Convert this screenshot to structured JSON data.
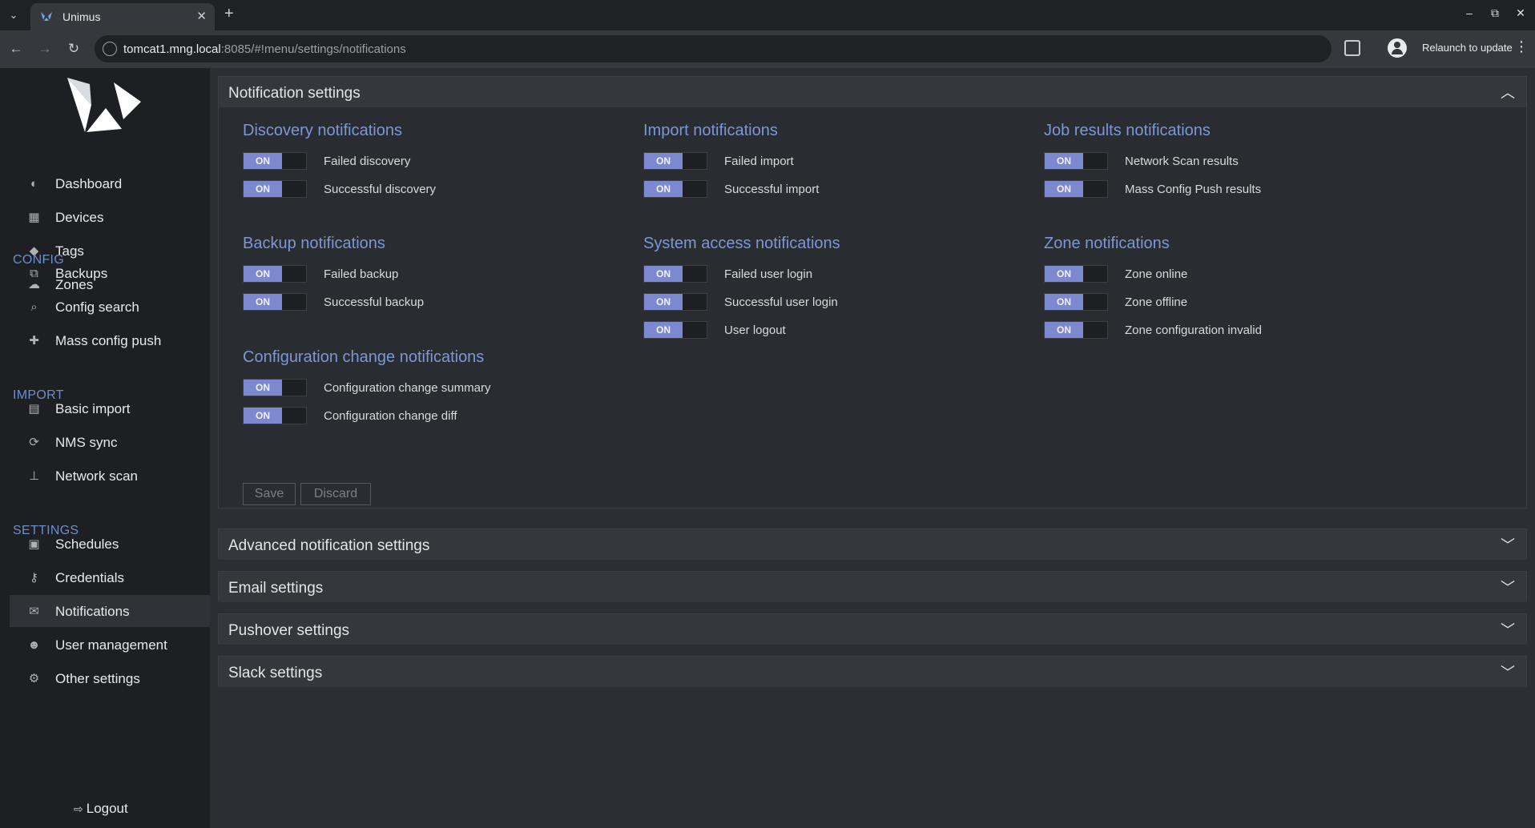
{
  "browser": {
    "tab_title": "Unimus",
    "url_host": "tomcat1.mng.local",
    "url_rest": ":8085/#!menu/settings/notifications",
    "relaunch_label": "Relaunch to update"
  },
  "sidebar": {
    "items_main": [
      {
        "label": "Dashboard",
        "icon": "dashboard-icon",
        "glyph": "◐"
      },
      {
        "label": "Devices",
        "icon": "devices-icon",
        "glyph": "▦"
      },
      {
        "label": "Tags",
        "icon": "tags-icon",
        "glyph": "◆"
      },
      {
        "label": "Zones",
        "icon": "cloud-icon",
        "glyph": "☁"
      }
    ],
    "section_config": "CONFIG",
    "items_config": [
      {
        "label": "Backups",
        "icon": "backups-icon",
        "glyph": "⧉"
      },
      {
        "label": "Config search",
        "icon": "search-icon",
        "glyph": "⌕"
      },
      {
        "label": "Mass config push",
        "icon": "puzzle-icon",
        "glyph": "✚"
      }
    ],
    "section_import": "IMPORT",
    "items_import": [
      {
        "label": "Basic import",
        "icon": "file-icon",
        "glyph": "▤"
      },
      {
        "label": "NMS sync",
        "icon": "sync-icon",
        "glyph": "⟳"
      },
      {
        "label": "Network scan",
        "icon": "network-icon",
        "glyph": "⊥"
      }
    ],
    "section_settings": "SETTINGS",
    "items_settings": [
      {
        "label": "Schedules",
        "icon": "calendar-icon",
        "glyph": "▣"
      },
      {
        "label": "Credentials",
        "icon": "key-icon",
        "glyph": "⚷"
      },
      {
        "label": "Notifications",
        "icon": "envelope-icon",
        "glyph": "✉"
      },
      {
        "label": "User management",
        "icon": "users-icon",
        "glyph": "☻"
      },
      {
        "label": "Other settings",
        "icon": "gears-icon",
        "glyph": "⚙"
      }
    ],
    "logout_label": "Logout"
  },
  "notification_settings": {
    "title": "Notification settings",
    "on_label": "ON",
    "groups": {
      "discovery": {
        "title": "Discovery notifications",
        "items": [
          "Failed discovery",
          "Successful discovery"
        ]
      },
      "backup": {
        "title": "Backup notifications",
        "items": [
          "Failed backup",
          "Successful backup"
        ]
      },
      "config_change": {
        "title": "Configuration change notifications",
        "items": [
          "Configuration change summary",
          "Configuration change diff"
        ]
      },
      "import": {
        "title": "Import notifications",
        "items": [
          "Failed import",
          "Successful import"
        ]
      },
      "system_access": {
        "title": "System access notifications",
        "items": [
          "Failed user login",
          "Successful user login",
          "User logout"
        ]
      },
      "job_results": {
        "title": "Job results notifications",
        "items": [
          "Network Scan results",
          "Mass Config Push results"
        ]
      },
      "zone": {
        "title": "Zone notifications",
        "items": [
          "Zone online",
          "Zone offline",
          "Zone configuration invalid"
        ]
      }
    },
    "save_label": "Save",
    "discard_label": "Discard"
  },
  "collapsed_panels": [
    "Advanced notification settings",
    "Email settings",
    "Pushover settings",
    "Slack settings"
  ],
  "colors": {
    "accent_title": "#7c97d6",
    "toggle_on": "#7c88d0",
    "sidebar_bg": "#1d1f22",
    "main_bg": "#2b2e32"
  }
}
